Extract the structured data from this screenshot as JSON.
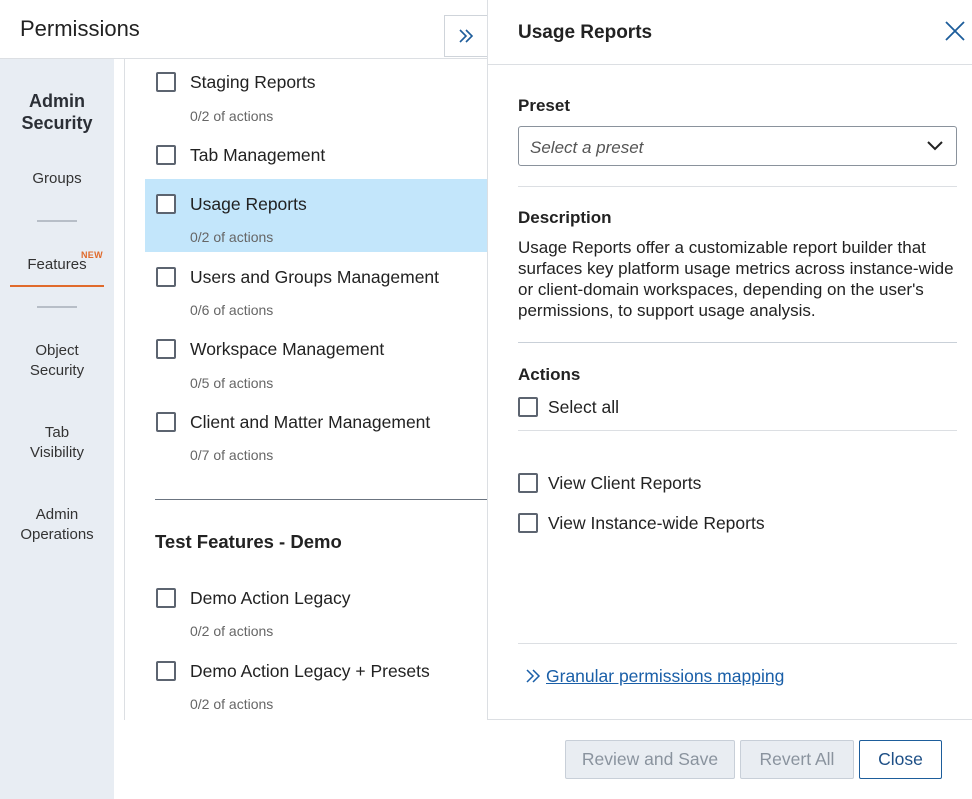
{
  "header": {
    "title": "Permissions"
  },
  "sidebar": {
    "heading_line1": "Admin",
    "heading_line2": "Security",
    "items": [
      {
        "label": "Groups"
      },
      {
        "label": "Features",
        "badge": "NEW"
      },
      {
        "label_line1": "Object",
        "label_line2": "Security"
      },
      {
        "label_line1": "Tab",
        "label_line2": "Visibility"
      },
      {
        "label_line1": "Admin",
        "label_line2": "Operations"
      }
    ]
  },
  "features": [
    {
      "label": "Staging Reports",
      "sub": "0/2 of actions"
    },
    {
      "label": "Tab Management",
      "sub": ""
    },
    {
      "label": "Usage Reports",
      "sub": "0/2 of actions"
    },
    {
      "label": "Users and Groups Management",
      "sub": "0/6 of actions"
    },
    {
      "label": "Workspace Management",
      "sub": "0/5 of actions"
    },
    {
      "label": "Client and Matter Management",
      "sub": "0/7 of actions"
    }
  ],
  "test_section": {
    "title": "Test Features - Demo",
    "items": [
      {
        "label": "Demo Action Legacy",
        "sub": "0/2 of actions"
      },
      {
        "label": "Demo Action Legacy + Presets",
        "sub": "0/2 of actions"
      }
    ]
  },
  "panel": {
    "title": "Usage Reports",
    "preset_label": "Preset",
    "preset_placeholder": "Select a preset",
    "description_label": "Description",
    "description_text": "Usage Reports offer a customizable report builder that surfaces key platform usage metrics across instance-wide or client-domain workspaces, depending on the user's permissions, to support usage analysis.",
    "actions_label": "Actions",
    "select_all": "Select all",
    "actions": [
      {
        "label": "View Client Reports"
      },
      {
        "label": "View Instance-wide Reports"
      }
    ],
    "link": "Granular permissions mapping"
  },
  "footer": {
    "review_save": "Review and Save",
    "revert_all": "Revert All",
    "close": "Close"
  },
  "colors": {
    "accent_orange": "#e06a2b",
    "selected_row": "#c3e6fb",
    "link_blue": "#1a5fa8",
    "sidebar_bg": "#e8edf3"
  }
}
